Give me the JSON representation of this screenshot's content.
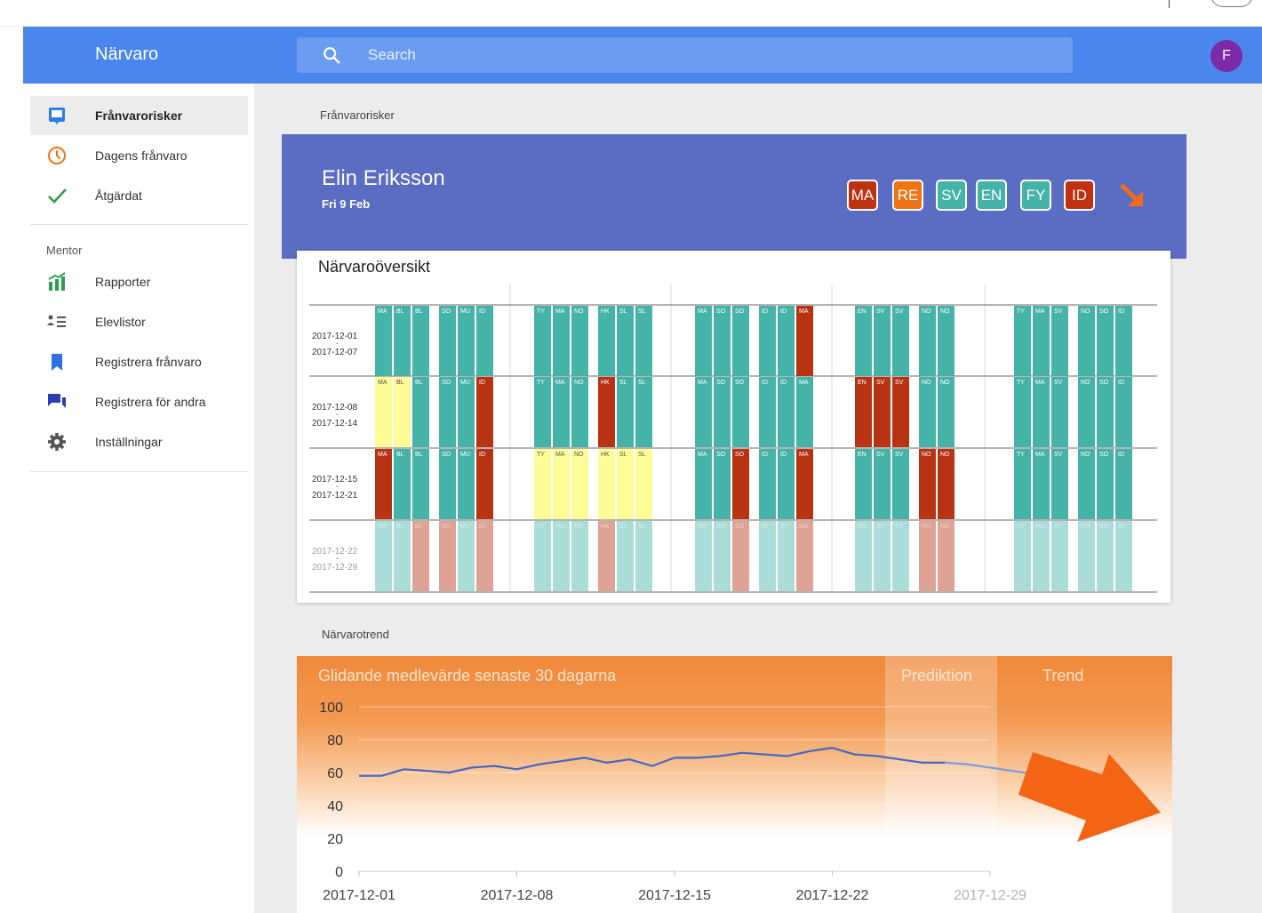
{
  "app": {
    "title": "Närvaro"
  },
  "search": {
    "placeholder": "Search"
  },
  "user": {
    "avatar_initial": "F"
  },
  "sidebar": {
    "items": [
      {
        "label": "Frånvarorisker",
        "icon": "inbox-icon",
        "active": true
      },
      {
        "label": "Dagens frånvaro",
        "icon": "clock-icon"
      },
      {
        "label": "Åtgärdat",
        "icon": "check-icon"
      }
    ],
    "section_label": "Mentor",
    "mentor_items": [
      {
        "label": "Rapporter",
        "icon": "bar-chart-icon"
      },
      {
        "label": "Elevlistor",
        "icon": "list-icon"
      },
      {
        "label": "Registrera frånvaro",
        "icon": "bookmark-icon"
      },
      {
        "label": "Registrera för andra",
        "icon": "chat-icon"
      },
      {
        "label": "Inställningar",
        "icon": "gear-icon"
      }
    ]
  },
  "main": {
    "breadcrumb": "Frånvarorisker",
    "student": {
      "name": "Elin Eriksson",
      "date": "Fri 9 Feb",
      "subjects": [
        {
          "code": "MA",
          "color": "#c0320f"
        },
        {
          "code": "RE",
          "color": "#f07414"
        },
        {
          "code": "SV",
          "color": "#45b3a8"
        },
        {
          "code": "EN",
          "color": "#45b3a8"
        },
        {
          "code": "FY",
          "color": "#45b3a8"
        },
        {
          "code": "ID",
          "color": "#c0320f"
        }
      ],
      "trend_icon": "arrow-down-right-icon"
    },
    "overview": {
      "title": "Närvaroöversikt",
      "weeks": [
        {
          "from": "2017-12-01",
          "to": "2017-12-07"
        },
        {
          "from": "2017-12-08",
          "to": "2017-12-14"
        },
        {
          "from": "2017-12-15",
          "to": "2017-12-21"
        },
        {
          "from": "2017-12-22",
          "to": "2017-12-29",
          "faded": true
        }
      ],
      "days": [
        {
          "lessons": [
            [
              "MA",
              "BL",
              "BL"
            ],
            [
              "SO",
              "MU",
              "ID"
            ]
          ]
        },
        {
          "lessons": [
            [
              "TY",
              "MA",
              "NO"
            ],
            [
              "HK",
              "SL",
              "SL"
            ]
          ]
        },
        {
          "lessons": [
            [
              "MA",
              "SO",
              "SO"
            ],
            [
              "ID",
              "ID",
              "MA"
            ]
          ]
        },
        {
          "lessons": [
            [
              "EN",
              "SV",
              "SV"
            ],
            [
              "NO",
              "NO"
            ]
          ]
        },
        {
          "lessons": [
            [
              "TY",
              "MA",
              "SV"
            ],
            [
              "NO",
              "SO",
              "ID"
            ]
          ]
        }
      ],
      "status": [
        [
          "GGGGGG",
          "GGGGGG",
          "GGGGGR",
          "GGGGG",
          "GGGGGG"
        ],
        [
          "YYGGGR",
          "GGGRGG",
          "GGGGGG",
          "RRRGG",
          "GGGGGG"
        ],
        [
          "RGGGGR",
          "YYYYYY",
          "GGRGGR",
          "GGGRR",
          "GGGGGG"
        ],
        [
          "GGRRGR",
          "GGGRGG",
          "GGRGGR",
          "GGGRR",
          "GGGGGG"
        ]
      ],
      "colors": {
        "green": "#45b3a8",
        "red": "#b73314",
        "yellow": "#fdfc96"
      }
    },
    "trend": {
      "section_label": "Närvarotrend",
      "panel_title": "Glidande medlevärde senaste 30 dagarna",
      "prediction_label": "Prediktion",
      "trend_label": "Trend",
      "trend_icon": "arrow-down-right-icon"
    }
  },
  "chart_data": {
    "type": "line",
    "title": "Glidande medlevärde senaste 30 dagarna",
    "xlabel": "",
    "ylabel": "",
    "ylim": [
      0,
      100
    ],
    "yticks": [
      0,
      20,
      40,
      60,
      80,
      100
    ],
    "xticks": [
      "2017-12-01",
      "2017-12-08",
      "2017-12-15",
      "2017-12-22",
      "2017-12-29"
    ],
    "series": [
      {
        "x": [
          "2017-12-01",
          "2017-12-02",
          "2017-12-03",
          "2017-12-04",
          "2017-12-05",
          "2017-12-06",
          "2017-12-07",
          "2017-12-08",
          "2017-12-09",
          "2017-12-10",
          "2017-12-11",
          "2017-12-12",
          "2017-12-13",
          "2017-12-14",
          "2017-12-15",
          "2017-12-16",
          "2017-12-17",
          "2017-12-18",
          "2017-12-19",
          "2017-12-20",
          "2017-12-21",
          "2017-12-22",
          "2017-12-23",
          "2017-12-24",
          "2017-12-25",
          "2017-12-26",
          "2017-12-27"
        ],
        "values": [
          58,
          58,
          62,
          61,
          60,
          63,
          64,
          62,
          65,
          67,
          69,
          66,
          68,
          64,
          69,
          69,
          70,
          72,
          71,
          70,
          73,
          75,
          71,
          70,
          68,
          66,
          66
        ]
      },
      {
        "x": [
          "2017-12-27",
          "2017-12-28",
          "2017-12-29",
          "2017-12-30",
          "2017-12-31"
        ],
        "values": [
          66,
          65,
          63,
          61,
          59
        ],
        "prediction": true
      }
    ],
    "prediction_range": [
      "2017-12-27",
      "2017-12-31"
    ]
  }
}
